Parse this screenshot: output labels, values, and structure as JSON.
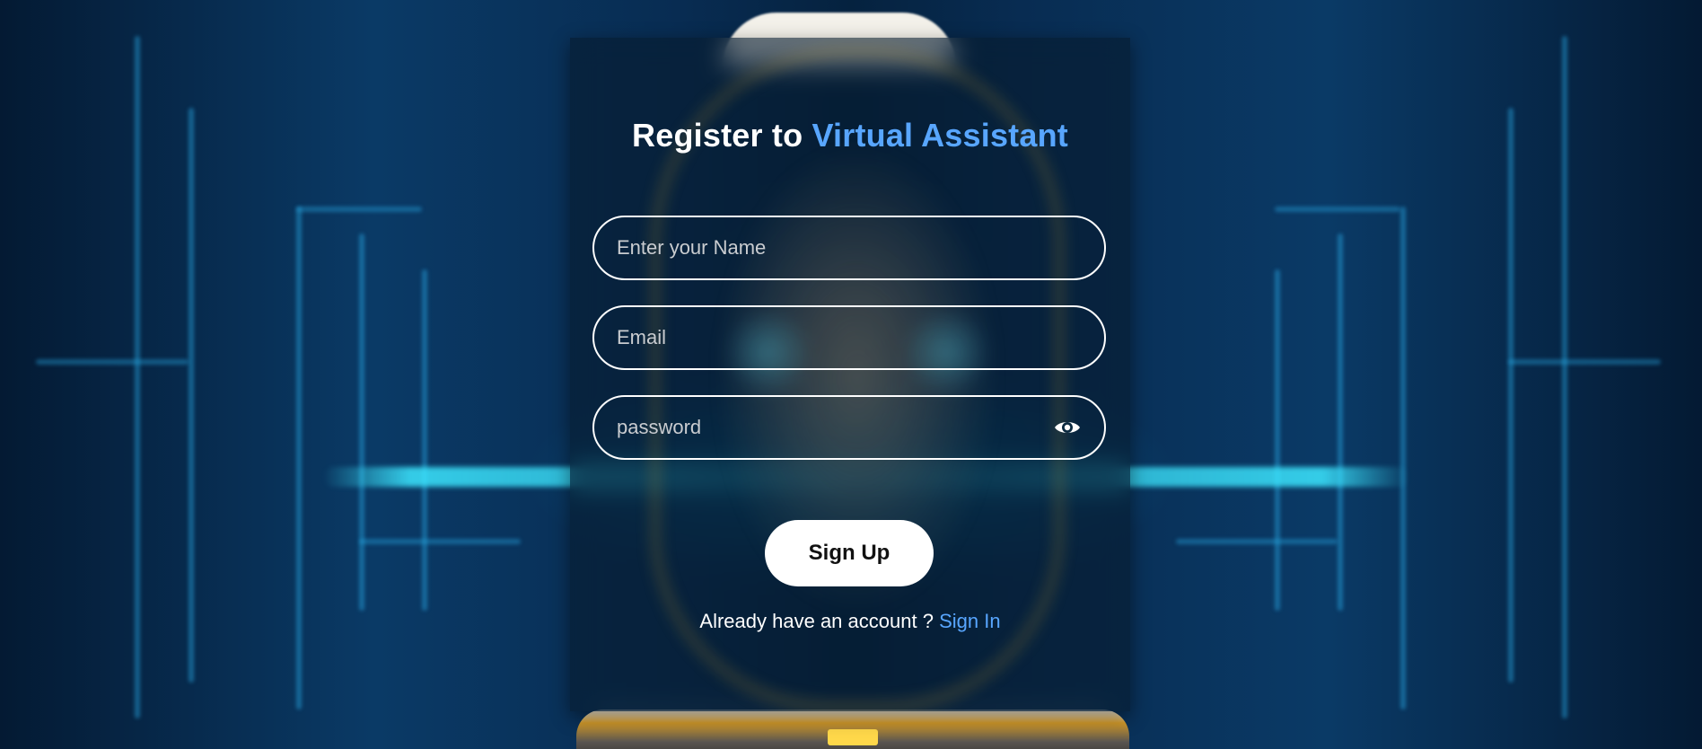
{
  "page": {
    "title_prefix": "Register to",
    "title_accent": "Virtual Assistant"
  },
  "form": {
    "name_placeholder": "Enter your Name",
    "email_placeholder": "Email",
    "password_placeholder": "password",
    "password_toggle_icon": "eye-icon",
    "submit_label": "Sign Up"
  },
  "footer": {
    "prompt": "Already have an account ?",
    "link_label": "Sign In"
  },
  "colors": {
    "accent": "#58a6ff",
    "text": "#ffffff",
    "button_bg": "#ffffff",
    "button_text": "#111111"
  }
}
